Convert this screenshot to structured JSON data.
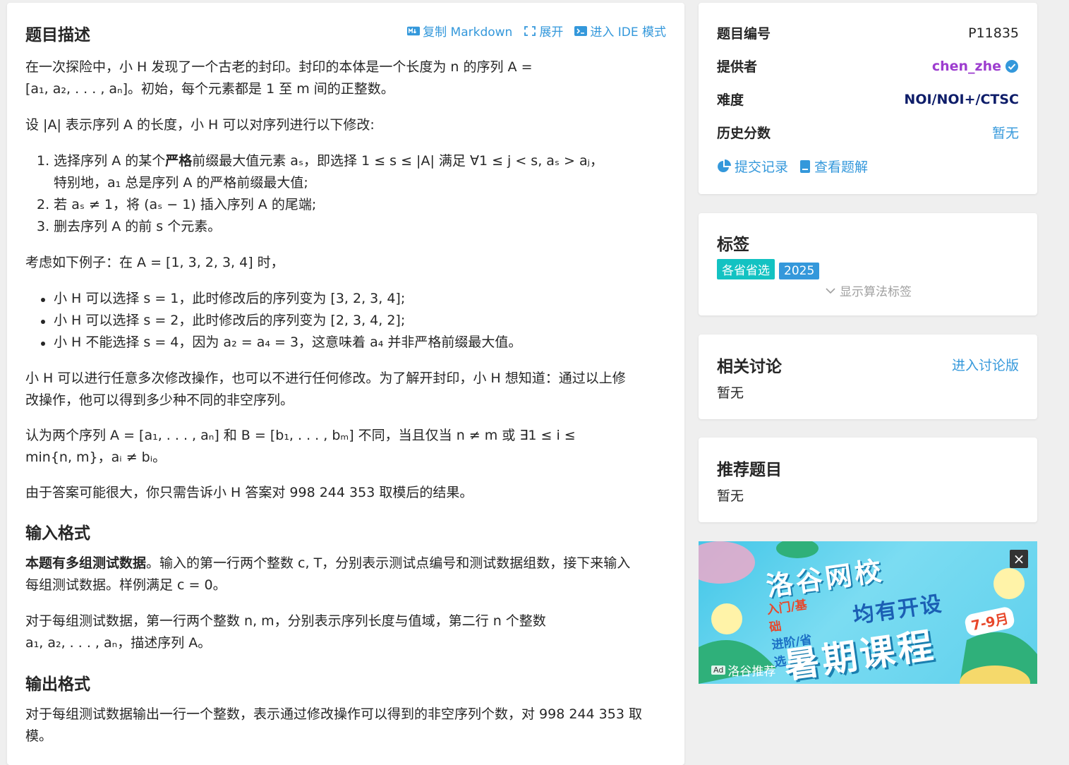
{
  "problem": {
    "title": "题目描述",
    "toolbar": {
      "copy": "复制 Markdown",
      "expand": "展开",
      "ide": "进入 IDE 模式"
    },
    "p1": "在一次探险中，小 H 发现了一个古老的封印。封印的本体是一个长度为 n 的序列 A =",
    "p1b": "[a₁, a₂, . . . , aₙ]。初始，每个元素都是 1 至 m 间的正整数。",
    "p2": "设 |A| 表示序列 A 的长度，小 H 可以对序列进行以下修改:",
    "ol1a": "1. 选择序列 A 的某个",
    "ol1bold": "严格",
    "ol1b": "前缀最大值元素 aₛ，即选择 1 ≤ s ≤ |A| 满足 ∀1 ≤ j < s, aₛ > aⱼ，",
    "ol1c": "特别地，a₁ 总是序列 A 的严格前缀最大值;",
    "ol2": "2. 若 aₛ ≠ 1，将 (aₛ − 1) 插入序列 A 的尾端;",
    "ol3": "3. 删去序列 A 的前 s 个元素。",
    "p3": "考虑如下例子：在 A = [1, 3, 2, 3, 4] 时，",
    "ul1": "小 H 可以选择 s = 1，此时修改后的序列变为 [3, 2, 3, 4];",
    "ul2": "小 H 可以选择 s = 2，此时修改后的序列变为 [2, 3, 4, 2];",
    "ul3": "小 H 不能选择 s = 4，因为 a₂ = a₄ = 3，这意味着 a₄ 并非严格前缀最大值。",
    "p4a": "小 H 可以进行任意多次修改操作，也可以不进行任何修改。为了解开封印，小 H 想知道：通过以上修",
    "p4b": "改操作，他可以得到多少种不同的非空序列。",
    "p5a": "认为两个序列 A = [a₁, . . . , aₙ] 和 B = [b₁, . . . , bₘ] 不同，当且仅当 n ≠ m 或 ∃1 ≤ i ≤",
    "p5b": "min{n, m}，aᵢ ≠ bᵢ。",
    "p6": "由于答案可能很大，你只需告诉小 H 答案对 998 244 353 取模后的结果。",
    "input_title": "输入格式",
    "in1bold": "本题有多组测试数据",
    "in1a": "。输入的第一行两个整数 c, T，分别表示测试点编号和测试数据组数，接下来输入",
    "in1b": "每组测试数据。样例满足 c = 0。",
    "in2a": "对于每组测试数据，第一行两个整数 n, m，分别表示序列长度与值域，第二行 n 个整数",
    "in2b": "a₁, a₂, . . . , aₙ，描述序列 A。",
    "output_title": "输出格式",
    "out1a": "对于每组测试数据输出一行一个整数，表示通过修改操作可以得到的非空序列个数，对 998 244 353 取",
    "out1b": "模。"
  },
  "info": {
    "id_label": "题目编号",
    "id_value": "P11835",
    "provider_label": "提供者",
    "provider_value": "chen_zhe",
    "difficulty_label": "难度",
    "difficulty_value": "NOI/NOI+/CTSC",
    "history_label": "历史分数",
    "history_value": "暂无",
    "submissions": "提交记录",
    "solutions": "查看题解"
  },
  "tags": {
    "title": "标签",
    "items": [
      "各省省选",
      "2025"
    ],
    "show_algo": "显示算法标签"
  },
  "discussion": {
    "title": "相关讨论",
    "link": "进入讨论版",
    "empty": "暂无"
  },
  "recommend": {
    "title": "推荐题目",
    "empty": "暂无"
  },
  "ad": {
    "brand": "洛谷网校",
    "line1a": "入门/基础",
    "line1b": "进阶/省选",
    "line2": "均有开设",
    "months": "7-9月",
    "course": "暑期课程",
    "ad_badge": "Ad",
    "ad_label": "洛谷推荐",
    "close": "×"
  },
  "colors": {
    "link": "#3498db",
    "provider": "#9d3dcf",
    "difficulty": "#0e1d69",
    "tag_region": "#13c2c2",
    "tag_year": "#3498db"
  }
}
